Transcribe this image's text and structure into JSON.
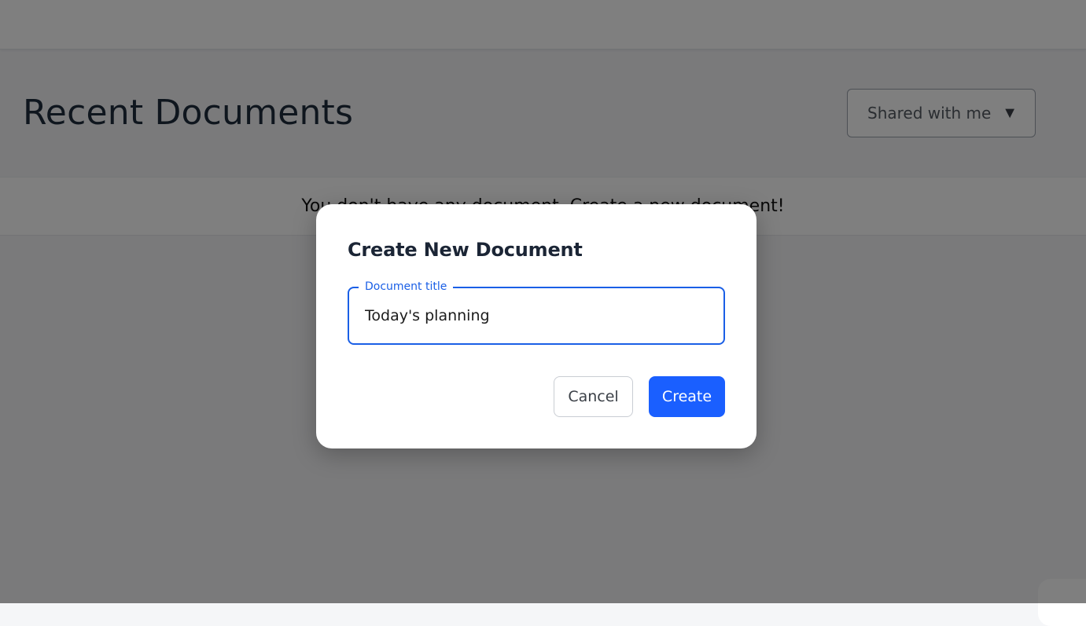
{
  "page": {
    "title": "Recent Documents"
  },
  "filter": {
    "selected": "Shared with me",
    "chevron": "▼"
  },
  "empty_state": {
    "message": "You don't have any document. Create a new document!"
  },
  "dialog": {
    "title": "Create New Document",
    "field_label": "Document title",
    "field_value": "Today's planning",
    "cancel_label": "Cancel",
    "create_label": "Create"
  },
  "colors": {
    "primary": "#1a5fff",
    "focus_border": "#1a5fe6",
    "title_text": "#1f2d3d"
  }
}
